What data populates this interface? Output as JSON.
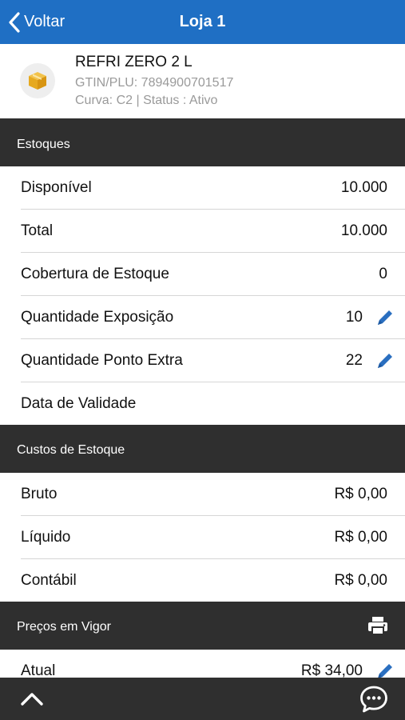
{
  "header": {
    "back_label": "Voltar",
    "title": "Loja 1"
  },
  "product": {
    "name": "REFRI ZERO 2 L",
    "gtin": "GTIN/PLU: 7894900701517",
    "curve_status": "Curva: C2 | Status : Ativo",
    "icon": "box-icon"
  },
  "estoques": {
    "title": "Estoques",
    "rows": [
      {
        "label": "Disponível",
        "value": "10.000"
      },
      {
        "label": "Total",
        "value": "10.000"
      },
      {
        "label": "Cobertura de Estoque",
        "value": "0"
      },
      {
        "label": "Quantidade Exposição",
        "value": "10"
      },
      {
        "label": "Quantidade Ponto Extra",
        "value": "22"
      },
      {
        "label": "Data de Validade",
        "value": ""
      }
    ]
  },
  "custos": {
    "title": "Custos de Estoque",
    "rows": [
      {
        "label": "Bruto",
        "value": "R$ 0,00"
      },
      {
        "label": "Líquido",
        "value": "R$ 0,00"
      },
      {
        "label": "Contábil",
        "value": "R$ 0,00"
      }
    ]
  },
  "precos": {
    "title": "Preços em Vigor",
    "rows": [
      {
        "label": "Atual",
        "value": "R$ 34,00"
      }
    ]
  },
  "colors": {
    "accent": "#1f6fc4",
    "section_bg": "#2f2f2f",
    "edit_icon": "#2a6fc0"
  }
}
